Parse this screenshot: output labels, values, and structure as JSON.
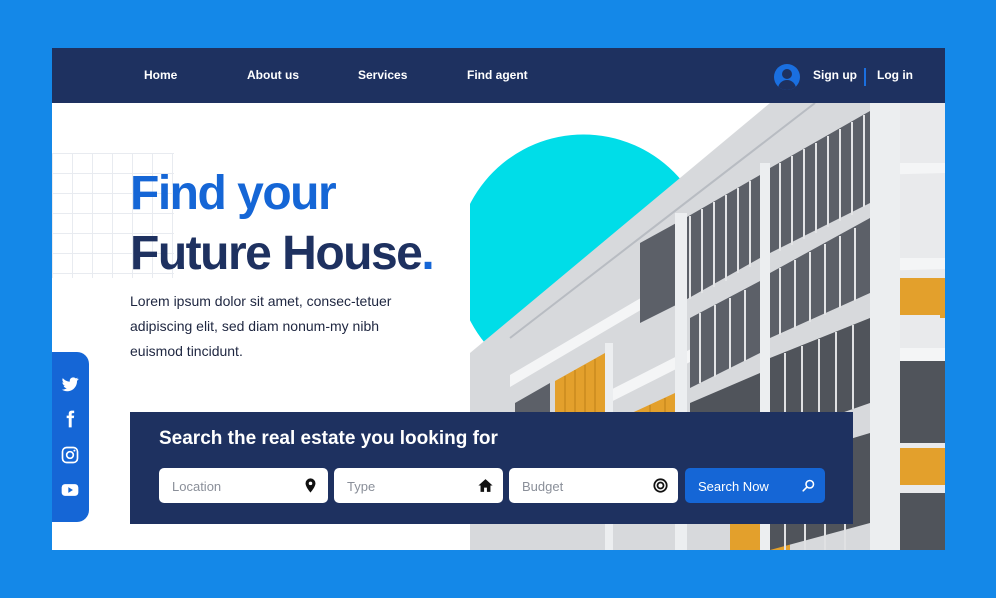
{
  "nav": {
    "links": [
      "Home",
      "About us",
      "Services",
      "Find agent"
    ],
    "signup": "Sign up",
    "login": "Log in"
  },
  "hero": {
    "title_line1": "Find your",
    "title_line2": "Future House",
    "title_dot": ".",
    "description": "Lorem ipsum dolor sit amet, consec-tetuer adipiscing elit, sed diam nonum-my nibh euismod tincidunt."
  },
  "social": [
    "twitter-icon",
    "facebook-icon",
    "instagram-icon",
    "youtube-icon"
  ],
  "search": {
    "title": "Search the real estate you looking for",
    "location_placeholder": "Location",
    "type_placeholder": "Type",
    "budget_placeholder": "Budget",
    "button_label": "Search Now"
  },
  "colors": {
    "background": "#1488e8",
    "navy": "#1e3160",
    "accent": "#1566d6",
    "cyan": "#00dde8"
  }
}
